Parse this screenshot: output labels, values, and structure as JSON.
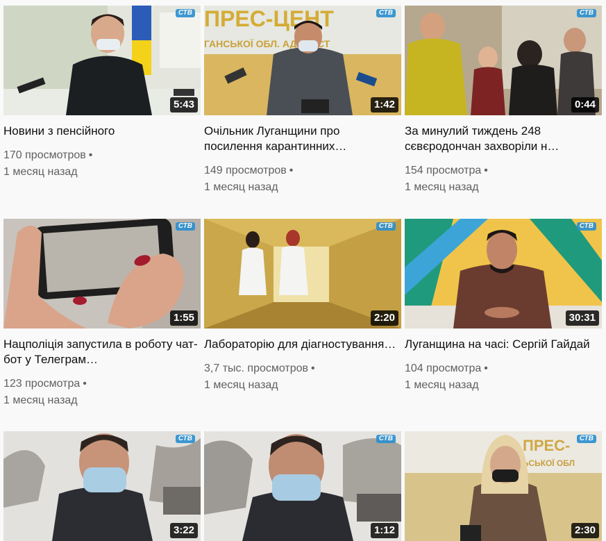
{
  "videos": [
    {
      "title": "Новини з пенсійного",
      "duration": "5:43",
      "views": "170 просмотров",
      "age": "1 месяц назад"
    },
    {
      "title": "Очільник Луганщини про посилення карантинних…",
      "duration": "1:42",
      "views": "149 просмотров",
      "age": "1 месяц назад"
    },
    {
      "title": "За минулий тиждень 248 сєвєродончан захворіли н…",
      "duration": "0:44",
      "views": "154 просмотра",
      "age": "1 месяц назад"
    },
    {
      "title": "Нацполіція запустила в роботу чат-бот у Телеграм…",
      "duration": "1:55",
      "views": "123 просмотра",
      "age": "1 месяц назад"
    },
    {
      "title": "Лабораторію для діагностування…",
      "duration": "2:20",
      "views": "3,7 тыс. просмотров",
      "age": "1 месяц назад"
    },
    {
      "title": "Луганщина на часі: Сергій Гайдай",
      "duration": "30:31",
      "views": "104 просмотра",
      "age": "1 месяц назад"
    },
    {
      "title": "",
      "duration": "3:22",
      "views": "",
      "age": ""
    },
    {
      "title": "",
      "duration": "1:12",
      "views": "",
      "age": ""
    },
    {
      "title": "",
      "duration": "2:30",
      "views": "",
      "age": ""
    }
  ],
  "separator": "•",
  "channel_logo": "СТВ",
  "icons": {
    "thumbnail": "video-thumbnail-icon"
  }
}
